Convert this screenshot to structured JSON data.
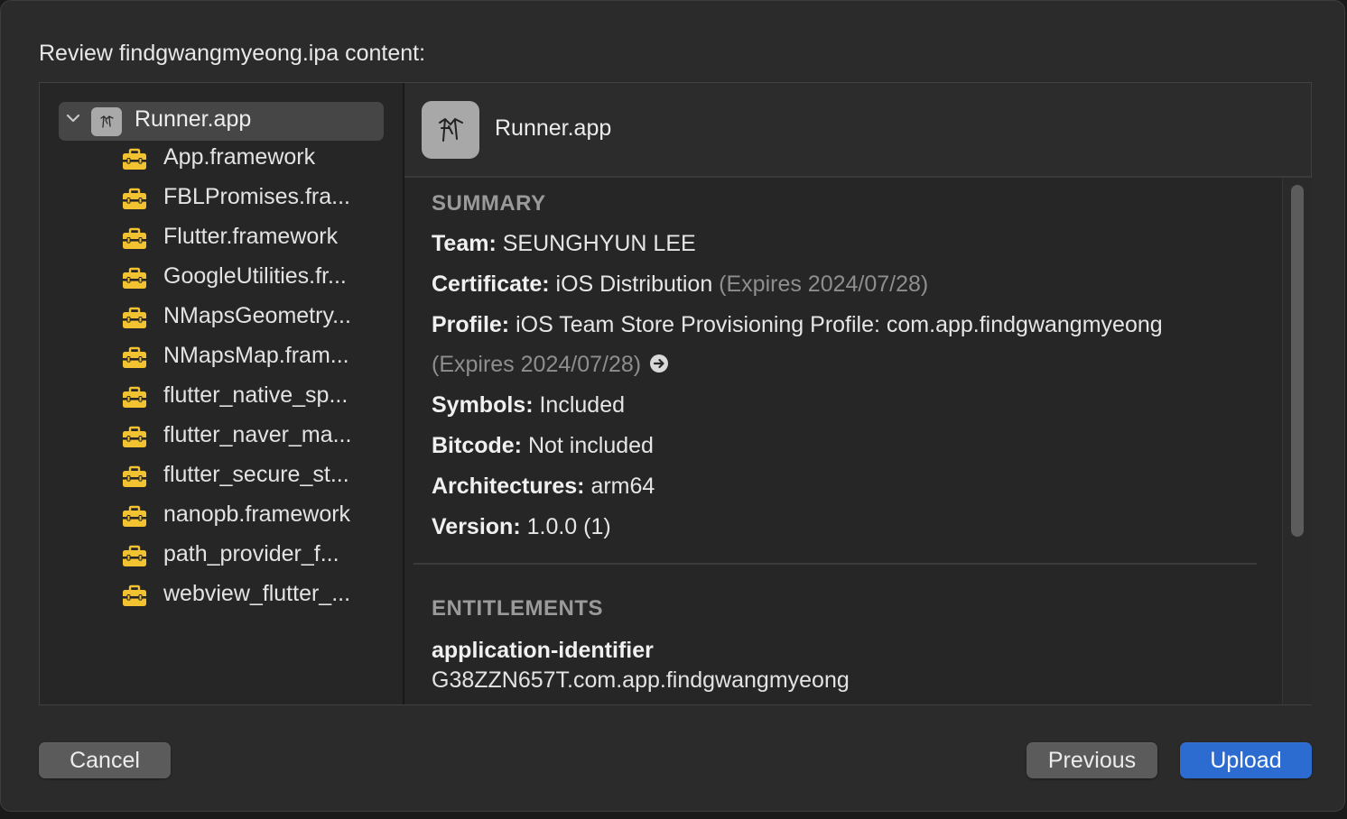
{
  "dialog": {
    "title": "Review findgwangmyeong.ipa content:"
  },
  "tree": {
    "root": {
      "label": "Runner.app",
      "expanded": true,
      "icon": "app-icon"
    },
    "children": [
      {
        "label": "App.framework",
        "icon": "framework-toolbox-icon"
      },
      {
        "label": "FBLPromises.fra...",
        "icon": "framework-toolbox-icon"
      },
      {
        "label": "Flutter.framework",
        "icon": "framework-toolbox-icon"
      },
      {
        "label": "GoogleUtilities.fr...",
        "icon": "framework-toolbox-icon"
      },
      {
        "label": "NMapsGeometry...",
        "icon": "framework-toolbox-icon"
      },
      {
        "label": "NMapsMap.fram...",
        "icon": "framework-toolbox-icon"
      },
      {
        "label": "flutter_native_sp...",
        "icon": "framework-toolbox-icon"
      },
      {
        "label": "flutter_naver_ma...",
        "icon": "framework-toolbox-icon"
      },
      {
        "label": "flutter_secure_st...",
        "icon": "framework-toolbox-icon"
      },
      {
        "label": "nanopb.framework",
        "icon": "framework-toolbox-icon"
      },
      {
        "label": "path_provider_f...",
        "icon": "framework-toolbox-icon"
      },
      {
        "label": "webview_flutter_...",
        "icon": "framework-toolbox-icon"
      }
    ]
  },
  "detail": {
    "app_name": "Runner.app",
    "summary_heading": "SUMMARY",
    "team_label": "Team:",
    "team_value": "SEUNGHYUN LEE",
    "certificate_label": "Certificate:",
    "certificate_value": "iOS Distribution",
    "certificate_expiry": "(Expires 2024/07/28)",
    "profile_label": "Profile:",
    "profile_value": "iOS Team Store Provisioning Profile: com.app.findgwangmyeong",
    "profile_expiry": "(Expires 2024/07/28)",
    "symbols_label": "Symbols:",
    "symbols_value": "Included",
    "bitcode_label": "Bitcode:",
    "bitcode_value": "Not included",
    "architectures_label": "Architectures:",
    "architectures_value": "arm64",
    "version_label": "Version:",
    "version_value": "1.0.0 (1)",
    "entitlements_heading": "ENTITLEMENTS",
    "entitlement_key": "application-identifier",
    "entitlement_value": "G38ZZN657T.com.app.findgwangmyeong"
  },
  "buttons": {
    "cancel": "Cancel",
    "previous": "Previous",
    "upload": "Upload"
  },
  "colors": {
    "accent": "#2c6cd1",
    "framework_icon": "#f2c230"
  }
}
